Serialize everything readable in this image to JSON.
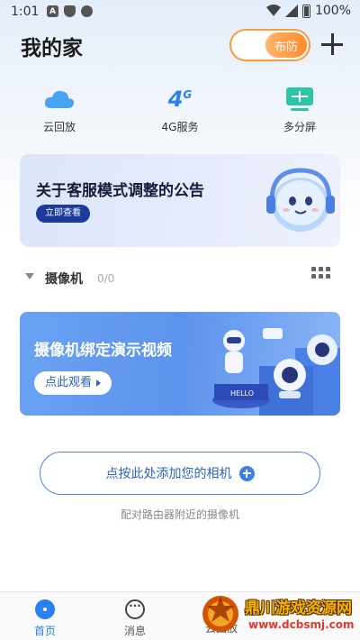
{
  "status_bar": {
    "time": "1:01",
    "left_icons": [
      "A",
      "shield",
      "circle"
    ],
    "battery": "100%"
  },
  "header": {
    "title": "我的家",
    "arm_toggle_label": "布防"
  },
  "quick_actions": [
    {
      "label": "云回放",
      "icon": "cloud-icon"
    },
    {
      "label": "4G服务",
      "icon": "4g-icon",
      "icon_text": "4"
    },
    {
      "label": "多分屏",
      "icon": "multi-screen-icon"
    }
  ],
  "notice_banner": {
    "title": "关于客服模式调整的公告",
    "button": "立即查看"
  },
  "camera_section": {
    "title": "摄像机",
    "count": "0/0"
  },
  "video_banner": {
    "title": "摄像机绑定演示视频",
    "button": "点此观看",
    "art_text": "HELLO"
  },
  "add_camera": {
    "label": "点按此处添加您的相机",
    "hint": "配对路由器附近的摄像机"
  },
  "tab_bar": {
    "tabs": [
      {
        "label": "首页",
        "active": true
      },
      {
        "label": "消息",
        "active": false
      }
    ],
    "partial_label": "云回放"
  },
  "watermark": {
    "title": "鼎川游戏资源网",
    "url": "www.dcbsmj.com"
  },
  "colors": {
    "accent": "#2a7ff0",
    "arm_orange": "#ff9a3c",
    "notice_button": "#1a3a9e"
  }
}
